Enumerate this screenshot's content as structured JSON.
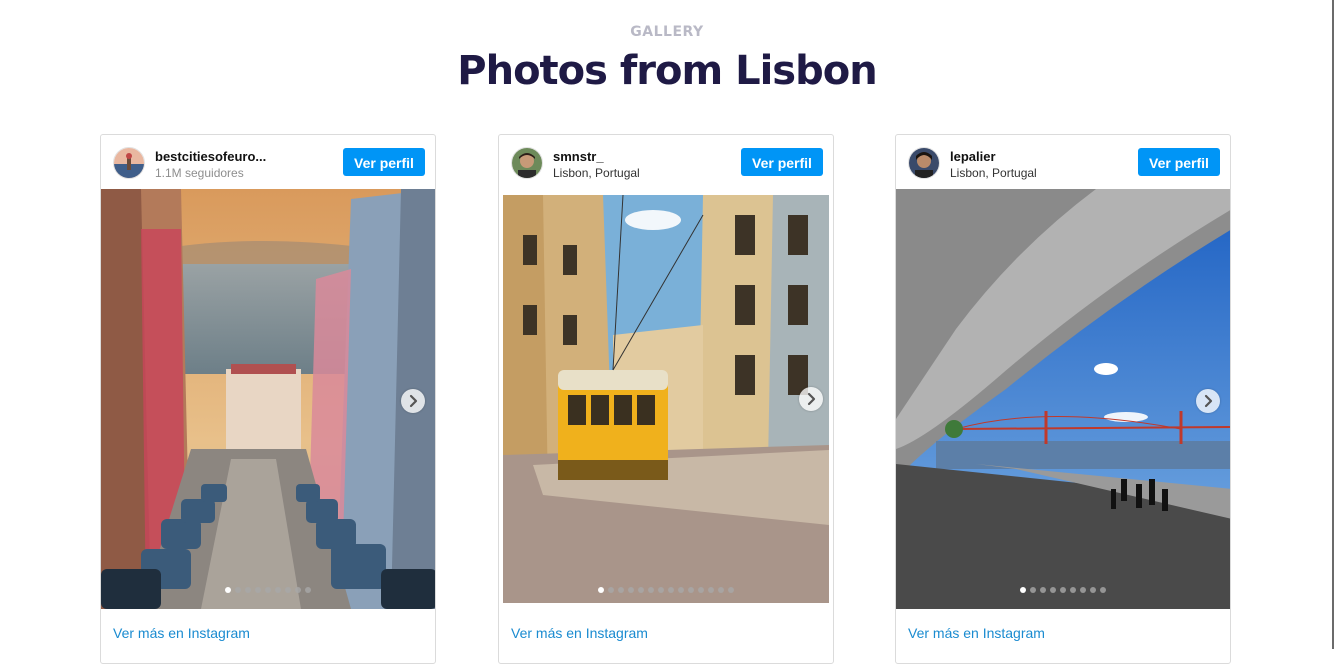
{
  "section": {
    "eyebrow": "GALLERY",
    "title": "Photos from Lisbon"
  },
  "cards": [
    {
      "username": "bestcitiesofeuro...",
      "subline": "1.1M seguidores",
      "button_label": "Ver perfil",
      "link_label": "Ver más en Instagram",
      "photo_subject": "Lisbon street descending to the river at sunset",
      "slide_count": 9,
      "active_slide": 1
    },
    {
      "username": "smnstr_",
      "subline": "Lisbon, Portugal",
      "button_label": "Ver perfil",
      "link_label": "Ver más en Instagram",
      "photo_subject": "Yellow tram on a Lisbon street",
      "slide_count": 14,
      "active_slide": 1
    },
    {
      "username": "lepalier",
      "subline": "Lisbon, Portugal",
      "button_label": "Ver perfil",
      "link_label": "Ver más en Instagram",
      "photo_subject": "MAAT curved roof with 25 de Abril bridge over the Tagus",
      "slide_count": 9,
      "active_slide": 1
    }
  ],
  "colors": {
    "title": "#1f1a45",
    "eyebrow": "#b9b9c6",
    "button_bg": "#0095f6",
    "link": "#1a8bd0"
  },
  "icons": {
    "next": "chevron-right-icon"
  }
}
